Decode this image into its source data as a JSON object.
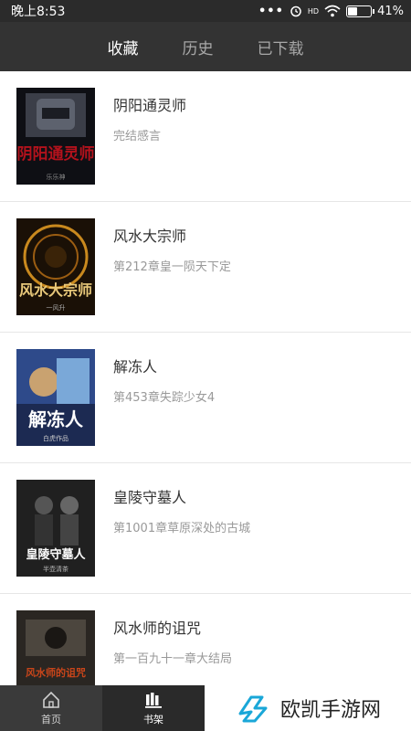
{
  "status_bar": {
    "time": "晚上8:53",
    "dots": "•••",
    "network": "HD",
    "battery_text": "41%",
    "battery_level": 0.41
  },
  "tabs": [
    {
      "label": "收藏",
      "active": true
    },
    {
      "label": "历史",
      "active": false
    },
    {
      "label": "已下载",
      "active": false
    }
  ],
  "books": [
    {
      "title": "阴阳通灵师",
      "chapter": "完结感言"
    },
    {
      "title": "风水大宗师",
      "chapter": "第212章皇一陨天下定"
    },
    {
      "title": "解冻人",
      "chapter": "第453章失踪少女4"
    },
    {
      "title": "皇陵守墓人",
      "chapter": "第1001章草原深处的古城"
    },
    {
      "title": "风水师的诅咒",
      "chapter": "第一百九十一章大结局"
    }
  ],
  "covers": [
    {
      "text": "阴阳通灵师",
      "author": "乐乐神"
    },
    {
      "text": "风水大宗师",
      "author": "一风升"
    },
    {
      "text": "解冻人",
      "author": "白虎作品"
    },
    {
      "text": "皇陵守墓人",
      "author": "半壶清茶"
    },
    {
      "text": "风水师的诅咒",
      "author": ""
    }
  ],
  "bottom_nav": {
    "home_label": "首页",
    "shelf_label": "书架"
  },
  "brand": {
    "name": "欧凯手游网",
    "color": "#1aa7d8"
  }
}
